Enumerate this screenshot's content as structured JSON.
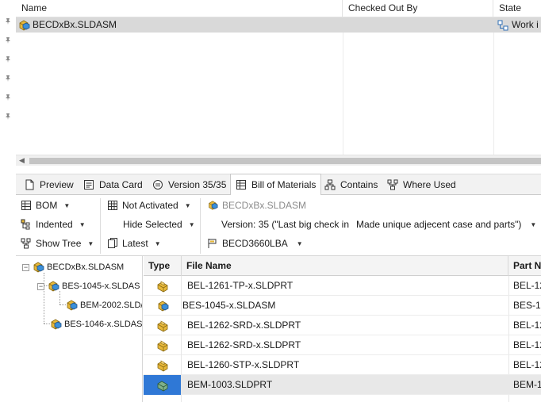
{
  "file_list": {
    "columns": {
      "name": "Name",
      "checked_out_by": "Checked Out By",
      "state": "State"
    },
    "rows": [
      {
        "name": "BECDxBx.SLDASM",
        "checked_out_by": "",
        "state": "Work i"
      }
    ]
  },
  "tabs": [
    {
      "label": "Preview",
      "icon": "preview-icon"
    },
    {
      "label": "Data Card",
      "icon": "data-card-icon"
    },
    {
      "label": "Version 35/35",
      "icon": "version-icon"
    },
    {
      "label": "Bill of Materials",
      "icon": "bom-table-icon",
      "active": true
    },
    {
      "label": "Contains",
      "icon": "contains-icon"
    },
    {
      "label": "Where Used",
      "icon": "where-used-icon"
    }
  ],
  "toolbar": {
    "bom": "BOM",
    "indented": "Indented",
    "show_tree": "Show Tree",
    "not_activated": "Not Activated",
    "hide_selected": "Hide Selected",
    "latest": "Latest",
    "file_name": "BECDxBx.SLDASM",
    "version_label": "Version: 35 (\"Last big check in",
    "version_comment": "Made unique adjecent case and parts\")",
    "config": "BECD3660LBA"
  },
  "tree": {
    "root": "BECDxBx.SLDASM",
    "children": [
      {
        "label": "BES-1045-x.SLDAS",
        "children": [
          {
            "label": "BEM-2002.SLD/"
          }
        ]
      },
      {
        "label": "BES-1046-x.SLDAS"
      }
    ]
  },
  "grid": {
    "columns": {
      "type": "Type",
      "file_name": "File Name",
      "part": "Part N"
    },
    "rows": [
      {
        "type": "part",
        "file_name": "BEL-1261-TP-x.SLDPRT",
        "part": "BEL-12"
      },
      {
        "type": "assembly",
        "file_name": "BES-1045-x.SLDASM",
        "part": "BES-10"
      },
      {
        "type": "part",
        "file_name": "BEL-1262-SRD-x.SLDPRT",
        "part": "BEL-12"
      },
      {
        "type": "part",
        "file_name": "BEL-1262-SRD-x.SLDPRT",
        "part": "BEL-12"
      },
      {
        "type": "part",
        "file_name": "BEL-1260-STP-x.SLDPRT",
        "part": "BEL-12"
      },
      {
        "type": "part-selected",
        "file_name": "BEM-1003.SLDPRT",
        "part": "BEM-1"
      }
    ]
  },
  "colors": {
    "selection_blue": "#2f78d6",
    "row_selected": "#d9d9d9",
    "part_icon_yellow": "#e8b93a",
    "assembly_icon_blue": "#3b8fd9"
  }
}
